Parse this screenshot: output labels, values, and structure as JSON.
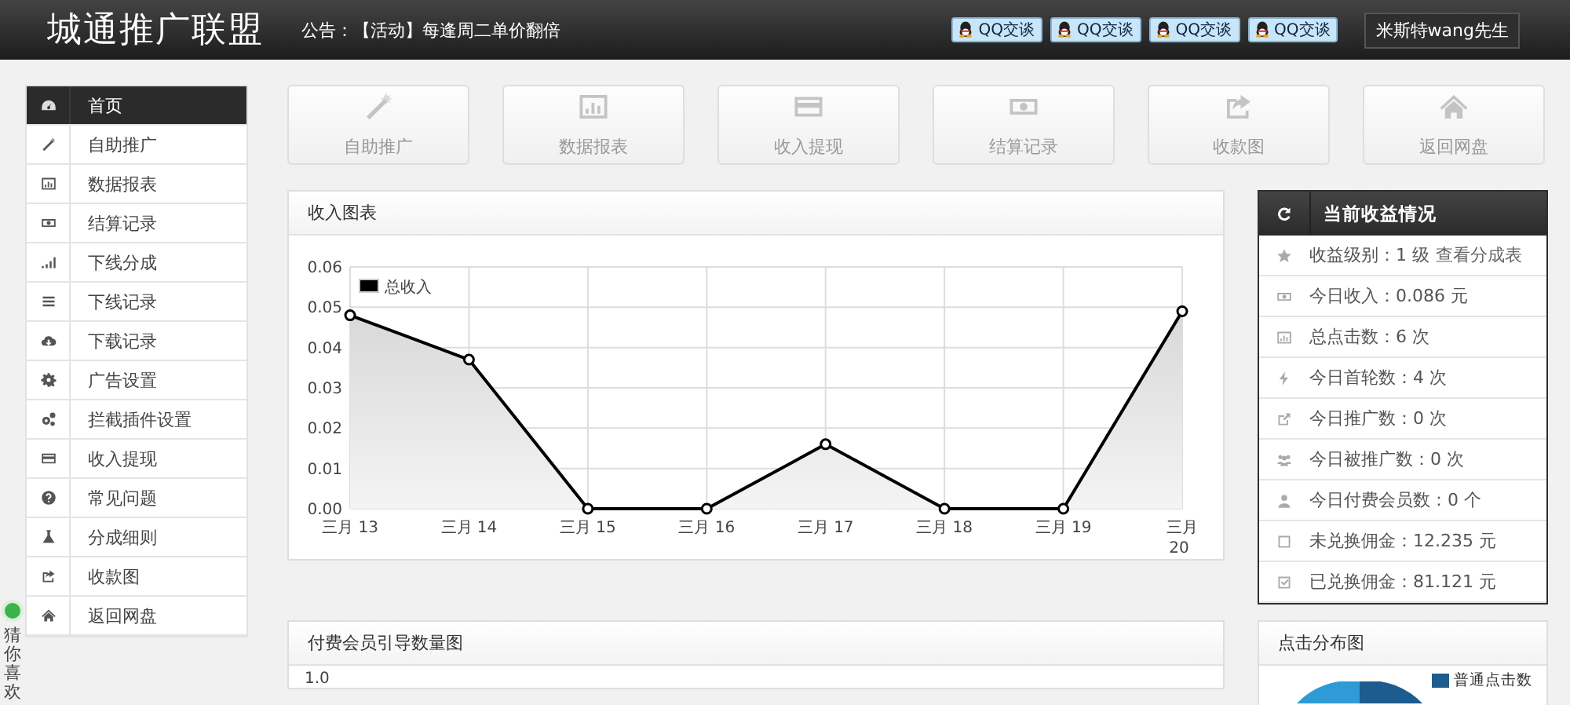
{
  "header": {
    "logo": "城通推广联盟",
    "notice": "公告：【活动】每逢周二单价翻倍",
    "qq_buttons": [
      "QQ交谈",
      "QQ交谈",
      "QQ交谈",
      "QQ交谈"
    ],
    "user": "米斯特wang先生"
  },
  "sidebar": {
    "items": [
      {
        "label": "首页",
        "selected": true
      },
      {
        "label": "自助推广",
        "selected": false
      },
      {
        "label": "数据报表",
        "selected": false
      },
      {
        "label": "结算记录",
        "selected": false
      },
      {
        "label": "下线分成",
        "selected": false
      },
      {
        "label": "下线记录",
        "selected": false
      },
      {
        "label": "下载记录",
        "selected": false
      },
      {
        "label": "广告设置",
        "selected": false
      },
      {
        "label": "拦截插件设置",
        "selected": false
      },
      {
        "label": "收入提现",
        "selected": false
      },
      {
        "label": "常见问题",
        "selected": false
      },
      {
        "label": "分成细则",
        "selected": false
      },
      {
        "label": "收款图",
        "selected": false
      },
      {
        "label": "返回网盘",
        "selected": false
      }
    ]
  },
  "side_widget": {
    "label": "猜你喜欢"
  },
  "shortcuts": [
    "自助推广",
    "数据报表",
    "收入提现",
    "结算记录",
    "收款图",
    "返回网盘"
  ],
  "income_chart": {
    "title": "收入图表",
    "chart_data": {
      "type": "area",
      "categories": [
        "三月 13",
        "三月 14",
        "三月 15",
        "三月 16",
        "三月 17",
        "三月 18",
        "三月 19",
        "三月 20"
      ],
      "series": [
        {
          "name": "总收入",
          "color": "#000000",
          "values": [
            0.048,
            0.037,
            0,
            0,
            0.016,
            0,
            0,
            0.049
          ]
        }
      ],
      "ylim": [
        0,
        0.06
      ],
      "grid": true,
      "yticks": [
        {
          "value": 0,
          "label": "0.00"
        },
        {
          "value": 0.01,
          "label": "0.01"
        },
        {
          "value": 0.02,
          "label": "0.02"
        },
        {
          "value": 0.03,
          "label": "0.03"
        },
        {
          "value": 0.04,
          "label": "0.04"
        },
        {
          "value": 0.05,
          "label": "0.05"
        },
        {
          "value": 0.06,
          "label": "0.06"
        }
      ]
    }
  },
  "earnings": {
    "title": "当前收益情况",
    "items": [
      {
        "text": "收益级别：1 级",
        "link": "查看分成表"
      },
      {
        "text": "今日收入：0.086 元"
      },
      {
        "text": "总点击数：6 次"
      },
      {
        "text": "今日首轮数：4 次"
      },
      {
        "text": "今日推广数：0 次"
      },
      {
        "text": "今日被推广数：0 次"
      },
      {
        "text": "今日付费会员数：0 个"
      },
      {
        "text": "未兑换佣金：12.235 元"
      },
      {
        "text": "已兑换佣金：81.121 元"
      }
    ]
  },
  "member_chart": {
    "title": "付费会员引导数量图",
    "y_tick": "1.0"
  },
  "click_chart": {
    "title": "点击分布图",
    "legend": "普通点击数"
  }
}
